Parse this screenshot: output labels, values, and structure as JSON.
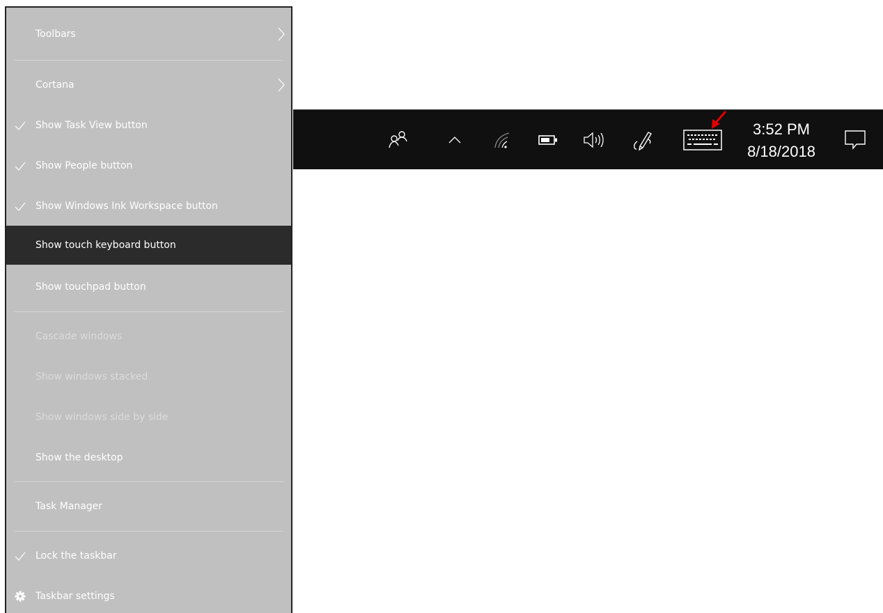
{
  "context_menu": {
    "items": [
      {
        "label": "Toolbars",
        "checked": false,
        "submenu": true,
        "enabled": true
      },
      {
        "label": "Cortana",
        "checked": false,
        "submenu": true,
        "enabled": true
      },
      {
        "label": "Show Task View button",
        "checked": true,
        "enabled": true
      },
      {
        "label": "Show People button",
        "checked": true,
        "enabled": true
      },
      {
        "label": "Show Windows Ink Workspace button",
        "checked": true,
        "enabled": true
      },
      {
        "label": "Show touch keyboard button",
        "checked": false,
        "enabled": true,
        "highlighted": true
      },
      {
        "label": "Show touchpad button",
        "checked": false,
        "enabled": true
      },
      {
        "label": "Cascade windows",
        "checked": false,
        "enabled": false
      },
      {
        "label": "Show windows stacked",
        "checked": false,
        "enabled": false
      },
      {
        "label": "Show windows side by side",
        "checked": false,
        "enabled": false
      },
      {
        "label": "Show the desktop",
        "checked": false,
        "enabled": true
      },
      {
        "label": "Task Manager",
        "checked": false,
        "enabled": true
      },
      {
        "label": "Lock the taskbar",
        "checked": true,
        "enabled": true
      },
      {
        "label": "Taskbar settings",
        "icon": "gear-icon",
        "enabled": true
      }
    ]
  },
  "taskbar": {
    "icons": [
      "people-icon",
      "chevron-up-icon",
      "wifi-icon",
      "battery-icon",
      "volume-icon",
      "ink-workspace-icon",
      "touch-keyboard-icon",
      "action-center-icon"
    ],
    "time": "3:52 PM",
    "date": "8/18/2018"
  },
  "colors": {
    "menu_bg": "#c0c0c0",
    "menu_highlight": "#2b2b2b",
    "taskbar_bg": "#101010",
    "annotation_arrow": "#e00000"
  }
}
